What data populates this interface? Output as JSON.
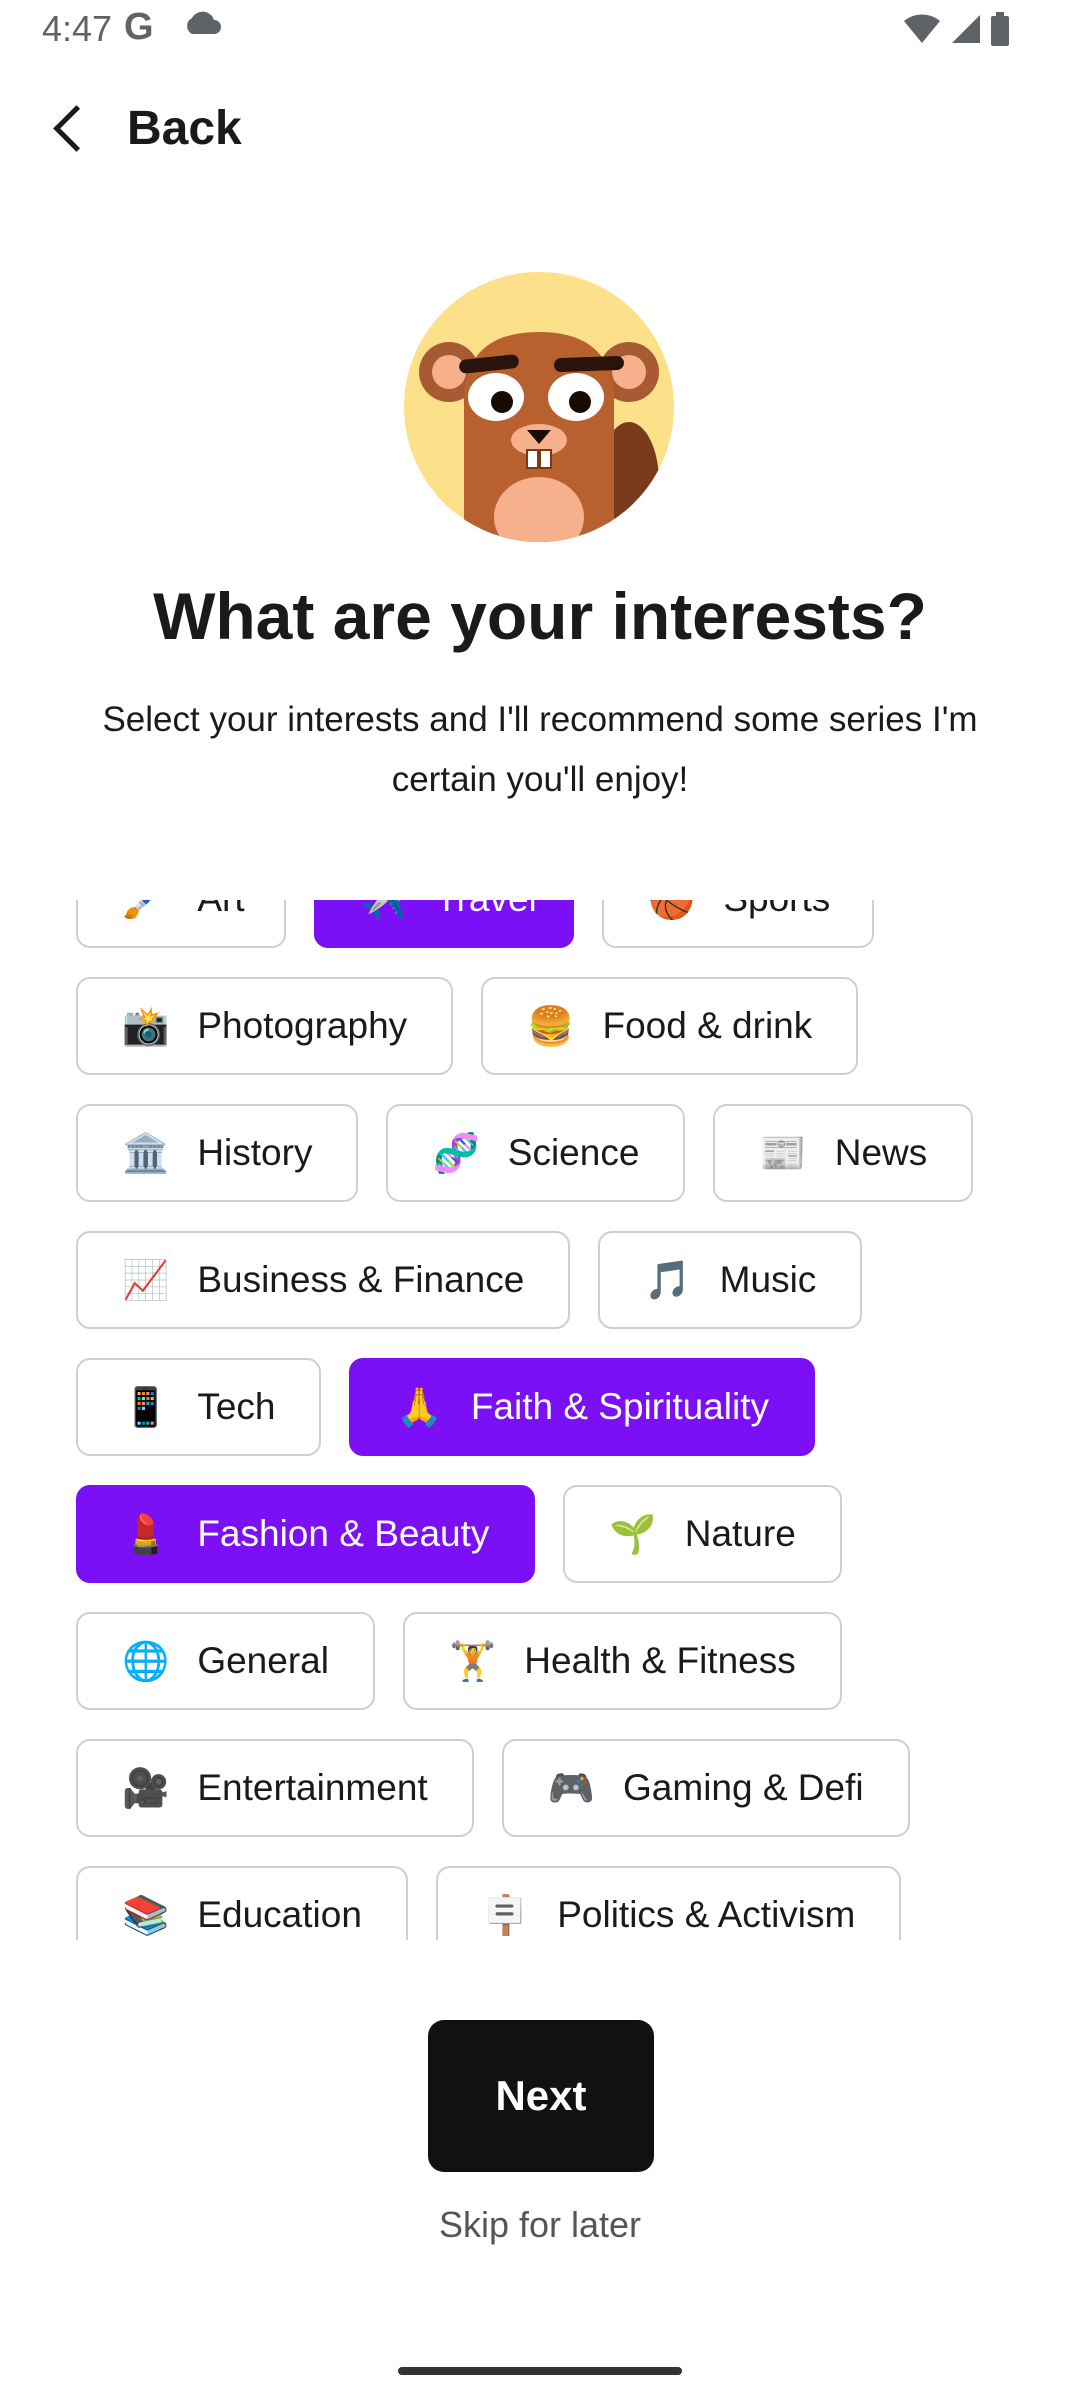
{
  "status_bar": {
    "time": "4:47",
    "g_label": "G"
  },
  "nav": {
    "back_label": "Back"
  },
  "header": {
    "title": "What are your interests?",
    "subtitle": "Select your interests and I'll recommend some series I'm certain you'll enjoy!"
  },
  "chips": [
    {
      "emoji": "🖌️",
      "label": "Art",
      "selected": false
    },
    {
      "emoji": "✈️",
      "label": "Travel",
      "selected": true
    },
    {
      "emoji": "🏀",
      "label": "Sports",
      "selected": false
    },
    {
      "emoji": "📸",
      "label": "Photography",
      "selected": false
    },
    {
      "emoji": "🍔",
      "label": "Food & drink",
      "selected": false
    },
    {
      "emoji": "🏛️",
      "label": "History",
      "selected": false
    },
    {
      "emoji": "🧬",
      "label": "Science",
      "selected": false
    },
    {
      "emoji": "📰",
      "label": "News",
      "selected": false
    },
    {
      "emoji": "📈",
      "label": "Business & Finance",
      "selected": false
    },
    {
      "emoji": "🎵",
      "label": "Music",
      "selected": false
    },
    {
      "emoji": "📱",
      "label": "Tech",
      "selected": false
    },
    {
      "emoji": "🙏",
      "label": "Faith & Spirituality",
      "selected": true
    },
    {
      "emoji": "💄",
      "label": "Fashion & Beauty",
      "selected": true
    },
    {
      "emoji": "🌱",
      "label": "Nature",
      "selected": false
    },
    {
      "emoji": "🌐",
      "label": "General",
      "selected": false
    },
    {
      "emoji": "🏋️",
      "label": "Health & Fitness",
      "selected": false
    },
    {
      "emoji": "🎥",
      "label": "Entertainment",
      "selected": false
    },
    {
      "emoji": "🎮",
      "label": "Gaming & Defi",
      "selected": false
    },
    {
      "emoji": "📚",
      "label": "Education",
      "selected": false
    },
    {
      "emoji": "🪧",
      "label": "Politics & Activism",
      "selected": false
    }
  ],
  "actions": {
    "next_label": "Next",
    "skip_label": "Skip for later"
  },
  "colors": {
    "accent": "#7b0ff5",
    "button": "#111111",
    "chip_border": "#cfcfcf"
  }
}
